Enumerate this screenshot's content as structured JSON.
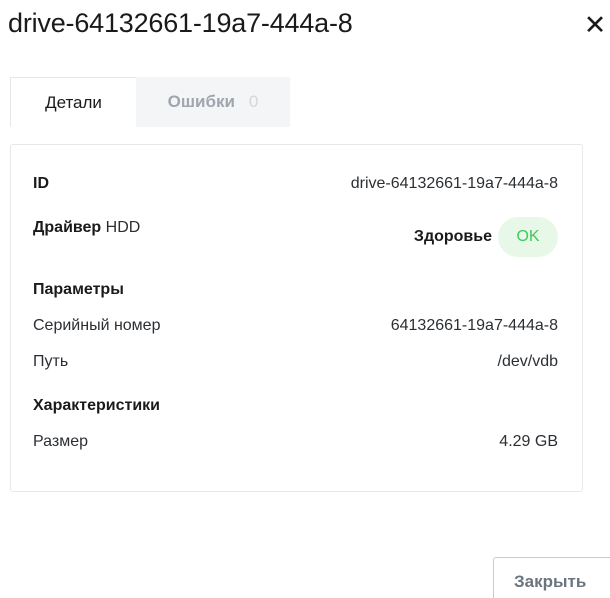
{
  "dialog": {
    "title": "drive-64132661-19a7-444a-8",
    "close_icon": "close-icon",
    "close_glyph": "✕"
  },
  "tabs": [
    {
      "label": "Детали",
      "active": true
    },
    {
      "label": "Ошибки",
      "count": "0",
      "active": false
    }
  ],
  "details": {
    "id_label": "ID",
    "id_value": "drive-64132661-19a7-444a-8",
    "driver_label": "Драйвер",
    "driver_value": "HDD",
    "health_label": "Здоровье",
    "health_value": "OK",
    "params_title": "Параметры",
    "serial_label": "Серийный номер",
    "serial_value": "64132661-19a7-444a-8",
    "path_label": "Путь",
    "path_value": "/dev/vdb",
    "specs_title": "Характеристики",
    "size_label": "Размер",
    "size_value": "4.29 GB"
  },
  "footer": {
    "close_button": "Закрыть"
  },
  "colors": {
    "ok_text": "#3ec95a",
    "ok_background": "#e7f8e9",
    "inactive_tab_background": "#f4f5f7"
  }
}
